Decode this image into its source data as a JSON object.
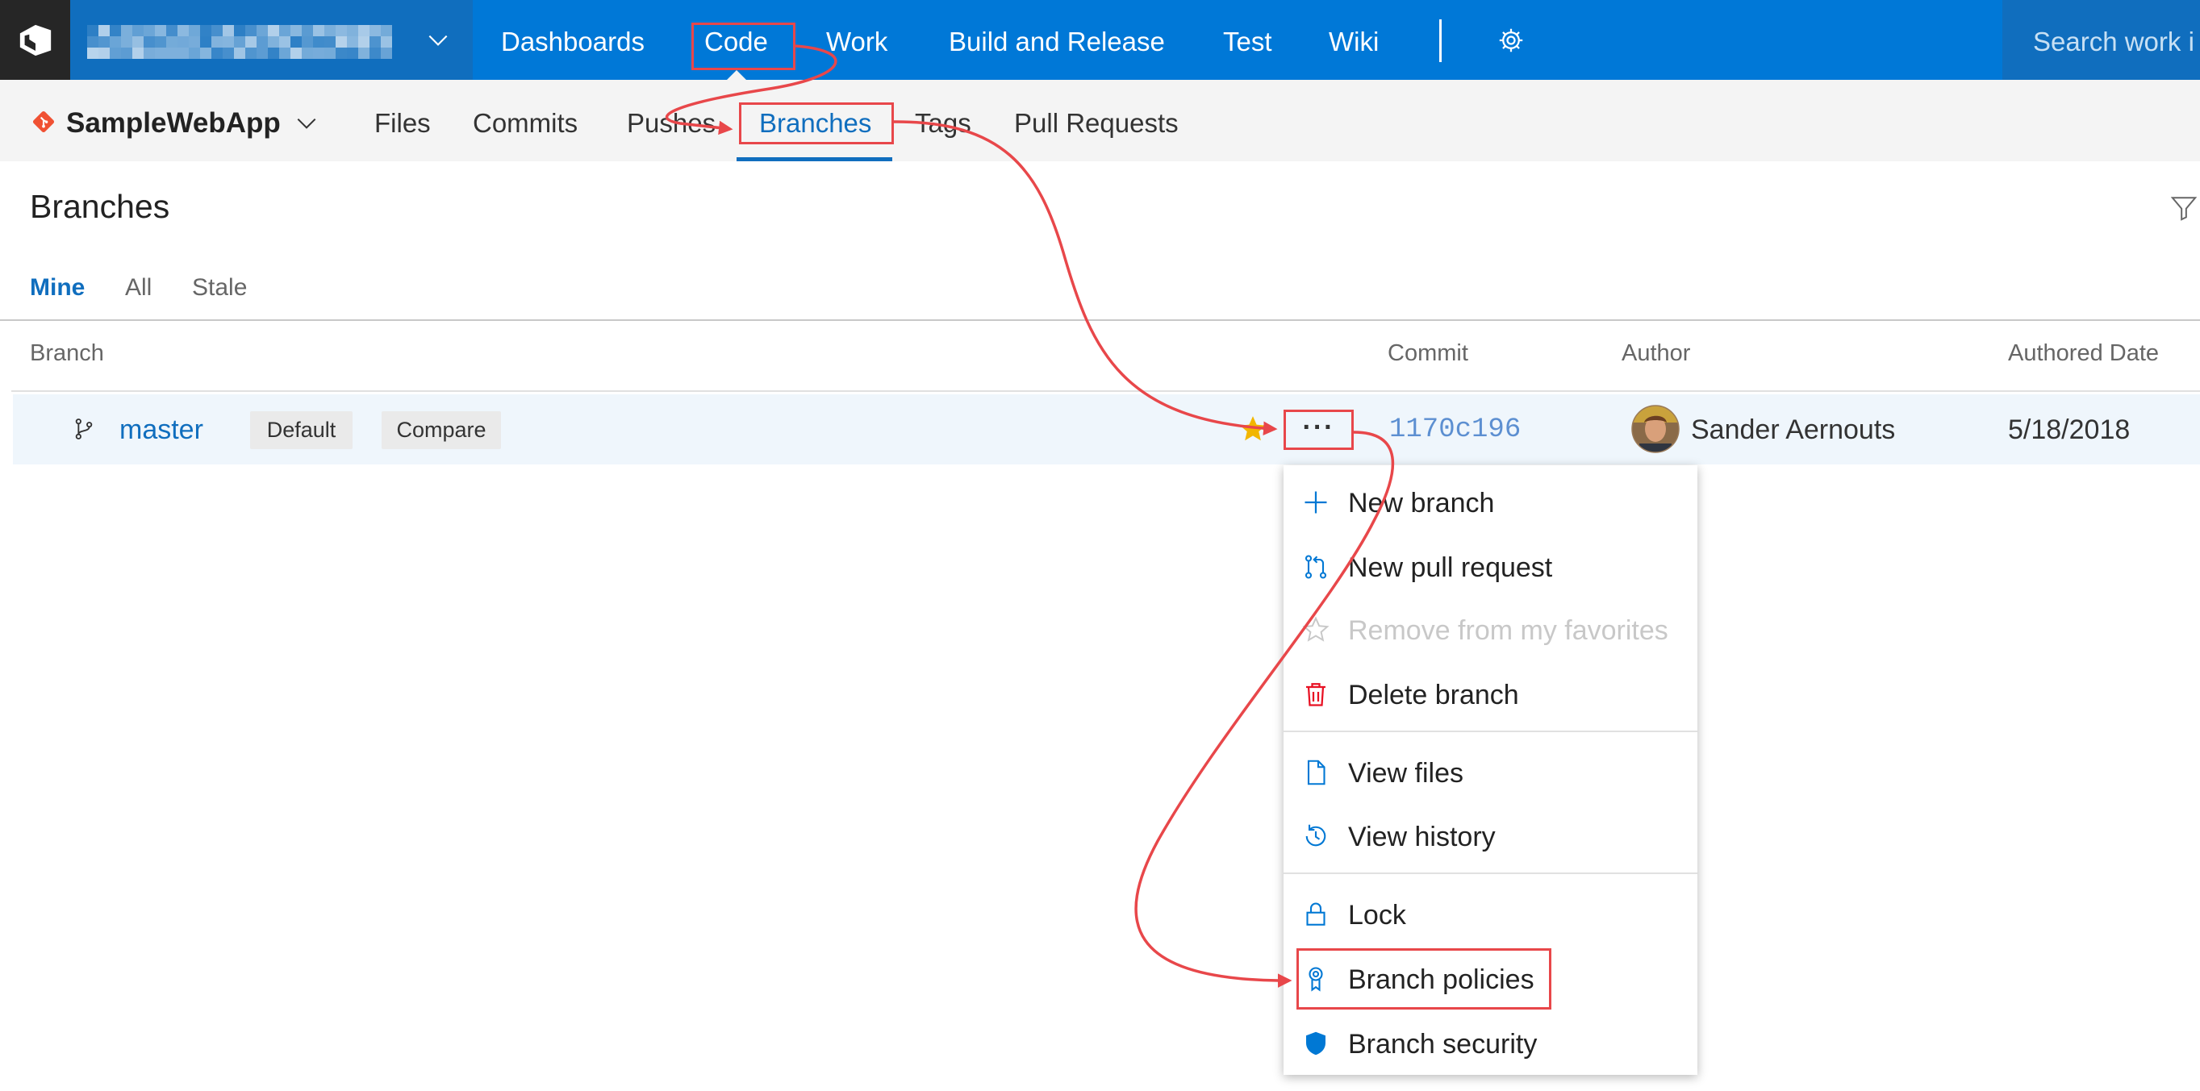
{
  "header": {
    "logo_icon": "azure-devops-logo-icon",
    "nav": [
      {
        "label": "Dashboards"
      },
      {
        "label": "Code",
        "selected": true
      },
      {
        "label": "Work"
      },
      {
        "label": "Build and Release"
      },
      {
        "label": "Test"
      },
      {
        "label": "Wiki"
      }
    ],
    "settings_icon": "gear-icon",
    "search_placeholder": "Search work i"
  },
  "repo": {
    "icon": "git-repo-icon",
    "name": "SampleWebApp",
    "tabs": [
      {
        "label": "Files"
      },
      {
        "label": "Commits"
      },
      {
        "label": "Pushes"
      },
      {
        "label": "Branches",
        "selected": true
      },
      {
        "label": "Tags"
      },
      {
        "label": "Pull Requests"
      }
    ]
  },
  "page": {
    "title": "Branches",
    "filter_icon": "filter-icon",
    "pivots": [
      {
        "label": "Mine",
        "selected": true
      },
      {
        "label": "All"
      },
      {
        "label": "Stale"
      }
    ]
  },
  "table": {
    "columns": [
      "Branch",
      "Commit",
      "Author",
      "Authored Date"
    ],
    "rows": [
      {
        "branch": "master",
        "badges": [
          "Default",
          "Compare"
        ],
        "favorite": true,
        "more_glyph": "···",
        "commit": "1170c196",
        "author": "Sander Aernouts",
        "authored_date": "5/18/2018"
      }
    ]
  },
  "context_menu": {
    "items": [
      {
        "label": "New branch",
        "icon": "plus-icon"
      },
      {
        "label": "New pull request",
        "icon": "pull-request-icon"
      },
      {
        "label": "Remove from my favorites",
        "icon": "star-outline-icon",
        "disabled": true
      },
      {
        "label": "Delete branch",
        "icon": "trash-icon"
      },
      {
        "label": "View files",
        "icon": "file-icon"
      },
      {
        "label": "View history",
        "icon": "history-icon"
      },
      {
        "label": "Lock",
        "icon": "lock-icon"
      },
      {
        "label": "Branch policies",
        "icon": "ribbon-icon",
        "highlighted": true
      },
      {
        "label": "Branch security",
        "icon": "shield-icon"
      }
    ]
  },
  "colors": {
    "top_bar": "#0078d7",
    "top_bar_dark": "#106ebe",
    "accent": "#106ebe",
    "selected_row": "#eff6fc",
    "favorite_star": "#f2b600",
    "delete": "#e81123",
    "annotation": "#e8474a",
    "git_icon": "#f05133"
  }
}
